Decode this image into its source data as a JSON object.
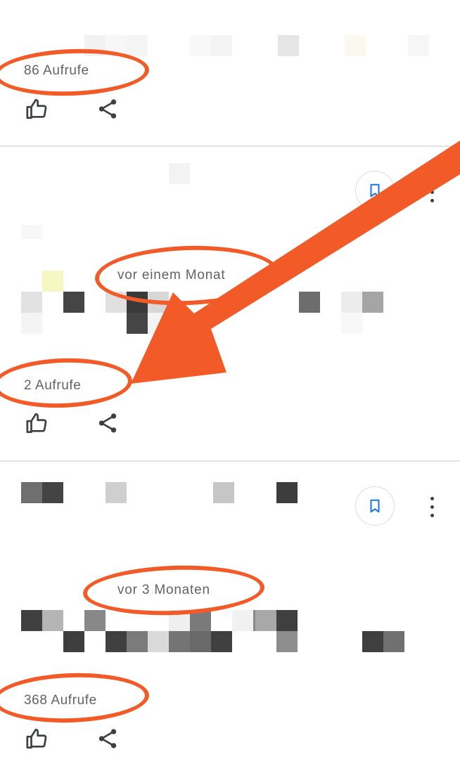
{
  "cards": [
    {
      "views": "86 Aufrufe"
    },
    {
      "time": "vor einem Monat",
      "views": "2 Aufrufe"
    },
    {
      "time": "vor 3 Monaten",
      "views": "368 Aufrufe"
    }
  ],
  "icons": {
    "like": "thumbs-up-icon",
    "share": "share-icon",
    "bookmark": "bookmark-icon",
    "more": "more-vert-icon"
  },
  "colors": {
    "annotation": "#f25a28",
    "bookmark": "#1a73e8",
    "text": "#5f6368"
  }
}
